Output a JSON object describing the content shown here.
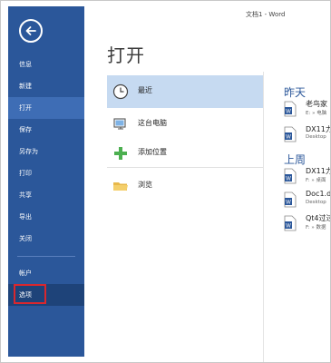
{
  "window": {
    "title": "文档1 - Word"
  },
  "page": {
    "title": "打开"
  },
  "sidebar": {
    "items": [
      {
        "label": "信息"
      },
      {
        "label": "新建"
      },
      {
        "label": "打开"
      },
      {
        "label": "保存"
      },
      {
        "label": "另存为"
      },
      {
        "label": "打印"
      },
      {
        "label": "共享"
      },
      {
        "label": "导出"
      },
      {
        "label": "关闭"
      },
      {
        "label": "帐户"
      },
      {
        "label": "选项"
      }
    ],
    "active_item": "打开",
    "highlighted_item": "选项"
  },
  "locations": [
    {
      "label": "最近",
      "icon": "clock-icon"
    },
    {
      "label": "这台电脑",
      "icon": "computer-icon"
    },
    {
      "label": "添加位置",
      "icon": "plus-icon"
    },
    {
      "label": "浏览",
      "icon": "folder-icon"
    }
  ],
  "recent": {
    "groups": [
      {
        "heading": "昨天",
        "files": [
          {
            "name": "老鸟家",
            "path": "E: » 电脑"
          },
          {
            "name": "DX11力",
            "path": "Desktop"
          }
        ]
      },
      {
        "heading": "上周",
        "files": [
          {
            "name": "DX11力",
            "path": "F: » 桌面"
          },
          {
            "name": "Doc1.d",
            "path": "Desktop"
          },
          {
            "name": "Qt4过过",
            "path": "F: » 数据"
          }
        ]
      }
    ]
  },
  "colors": {
    "sidebar": "#2b579a",
    "accent": "#2b579a",
    "selected_location": "#c6daf1",
    "highlight_box": "#d9272e"
  }
}
